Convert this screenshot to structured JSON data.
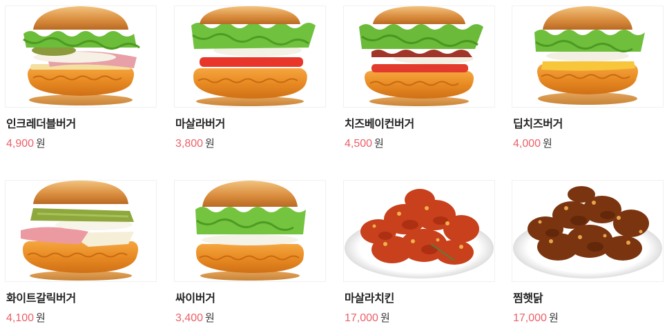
{
  "products": [
    {
      "name": "인크레더블버거",
      "price": "4,900",
      "unit": "원",
      "image": "burger-ham"
    },
    {
      "name": "마살라버거",
      "price": "3,800",
      "unit": "원",
      "image": "burger-tomato"
    },
    {
      "name": "치즈베이컨버거",
      "price": "4,500",
      "unit": "원",
      "image": "burger-bacon"
    },
    {
      "name": "딥치즈버거",
      "price": "4,000",
      "unit": "원",
      "image": "burger-cheese"
    },
    {
      "name": "화이트갈릭버거",
      "price": "4,100",
      "unit": "원",
      "image": "burger-pickle-ham"
    },
    {
      "name": "싸이버거",
      "price": "3,400",
      "unit": "원",
      "image": "burger-classic"
    },
    {
      "name": "마살라치킨",
      "price": "17,000",
      "unit": "원",
      "image": "chicken-masala"
    },
    {
      "name": "찜햇닭",
      "price": "17,000",
      "unit": "원",
      "image": "chicken-jjim"
    }
  ],
  "colors": {
    "price": "#e8323c",
    "name": "#222222",
    "unit": "#333333"
  }
}
